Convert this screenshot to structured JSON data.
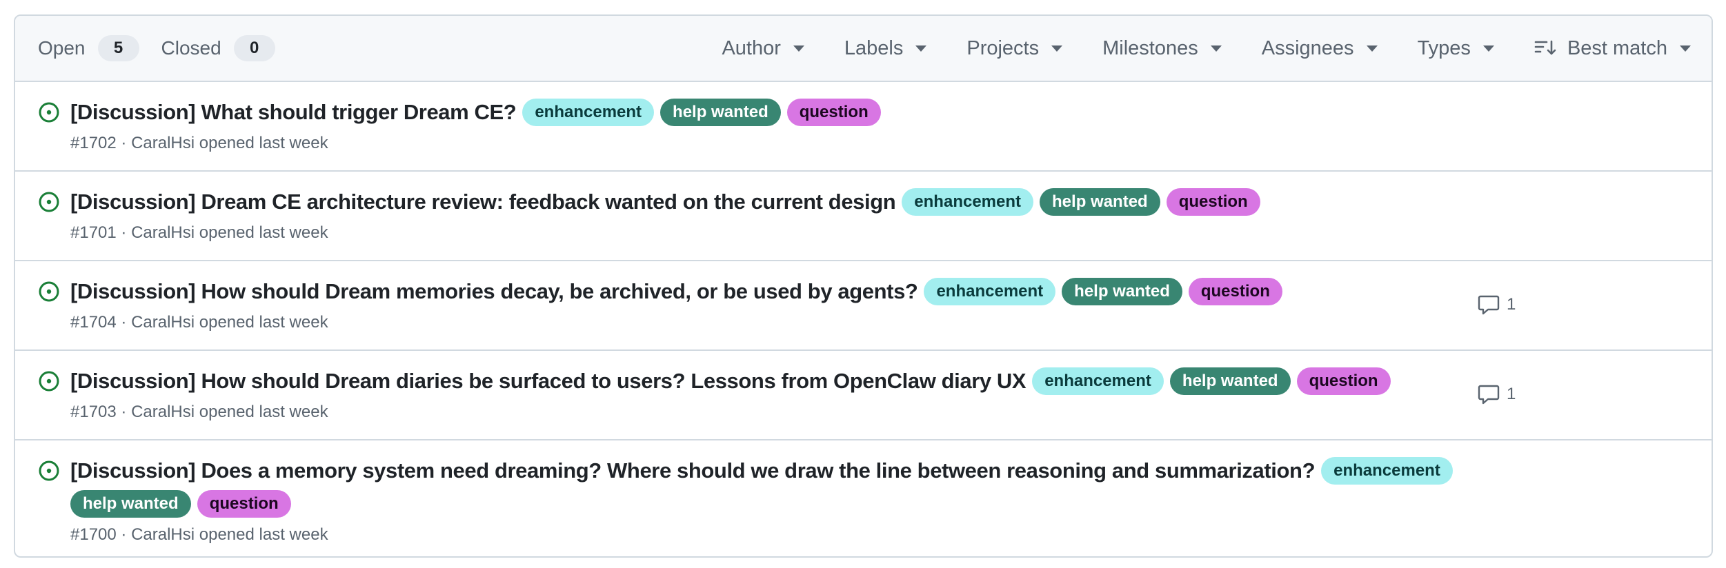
{
  "tabs": {
    "open_label": "Open",
    "open_count": "5",
    "closed_label": "Closed",
    "closed_count": "0"
  },
  "filters": [
    "Author",
    "Labels",
    "Projects",
    "Milestones",
    "Assignees",
    "Types"
  ],
  "sort": {
    "label": "Best match"
  },
  "label_styles": {
    "enhancement": {
      "bg": "#a2eeef",
      "fg": "#0a3b3c"
    },
    "help wanted": {
      "bg": "#398672",
      "fg": "#ffffff"
    },
    "question": {
      "bg": "#d876e3",
      "fg": "#1c0720"
    }
  },
  "status_color": "#1a7f37",
  "issues": [
    {
      "title": "[Discussion] What should trigger Dream CE?",
      "labels": [
        "enhancement",
        "help wanted",
        "question"
      ],
      "number": "#1702",
      "author": "CaralHsi",
      "opened": "opened last week",
      "comments": ""
    },
    {
      "title": "[Discussion] Dream CE architecture review: feedback wanted on the current design",
      "labels": [
        "enhancement",
        "help wanted",
        "question"
      ],
      "number": "#1701",
      "author": "CaralHsi",
      "opened": "opened last week",
      "comments": ""
    },
    {
      "title": "[Discussion] How should Dream memories decay, be archived, or be used by agents?",
      "labels": [
        "enhancement",
        "help wanted",
        "question"
      ],
      "number": "#1704",
      "author": "CaralHsi",
      "opened": "opened last week",
      "comments": "1"
    },
    {
      "title": "[Discussion] How should Dream diaries be surfaced to users? Lessons from OpenClaw diary UX",
      "labels": [
        "enhancement",
        "help wanted",
        "question"
      ],
      "number": "#1703",
      "author": "CaralHsi",
      "opened": "opened last week",
      "comments": "1"
    },
    {
      "title": "[Discussion] Does a memory system need dreaming? Where should we draw the line between reasoning and summarization?",
      "labels": [
        "enhancement",
        "help wanted",
        "question"
      ],
      "number": "#1700",
      "author": "CaralHsi",
      "opened": "opened last week",
      "comments": ""
    }
  ]
}
